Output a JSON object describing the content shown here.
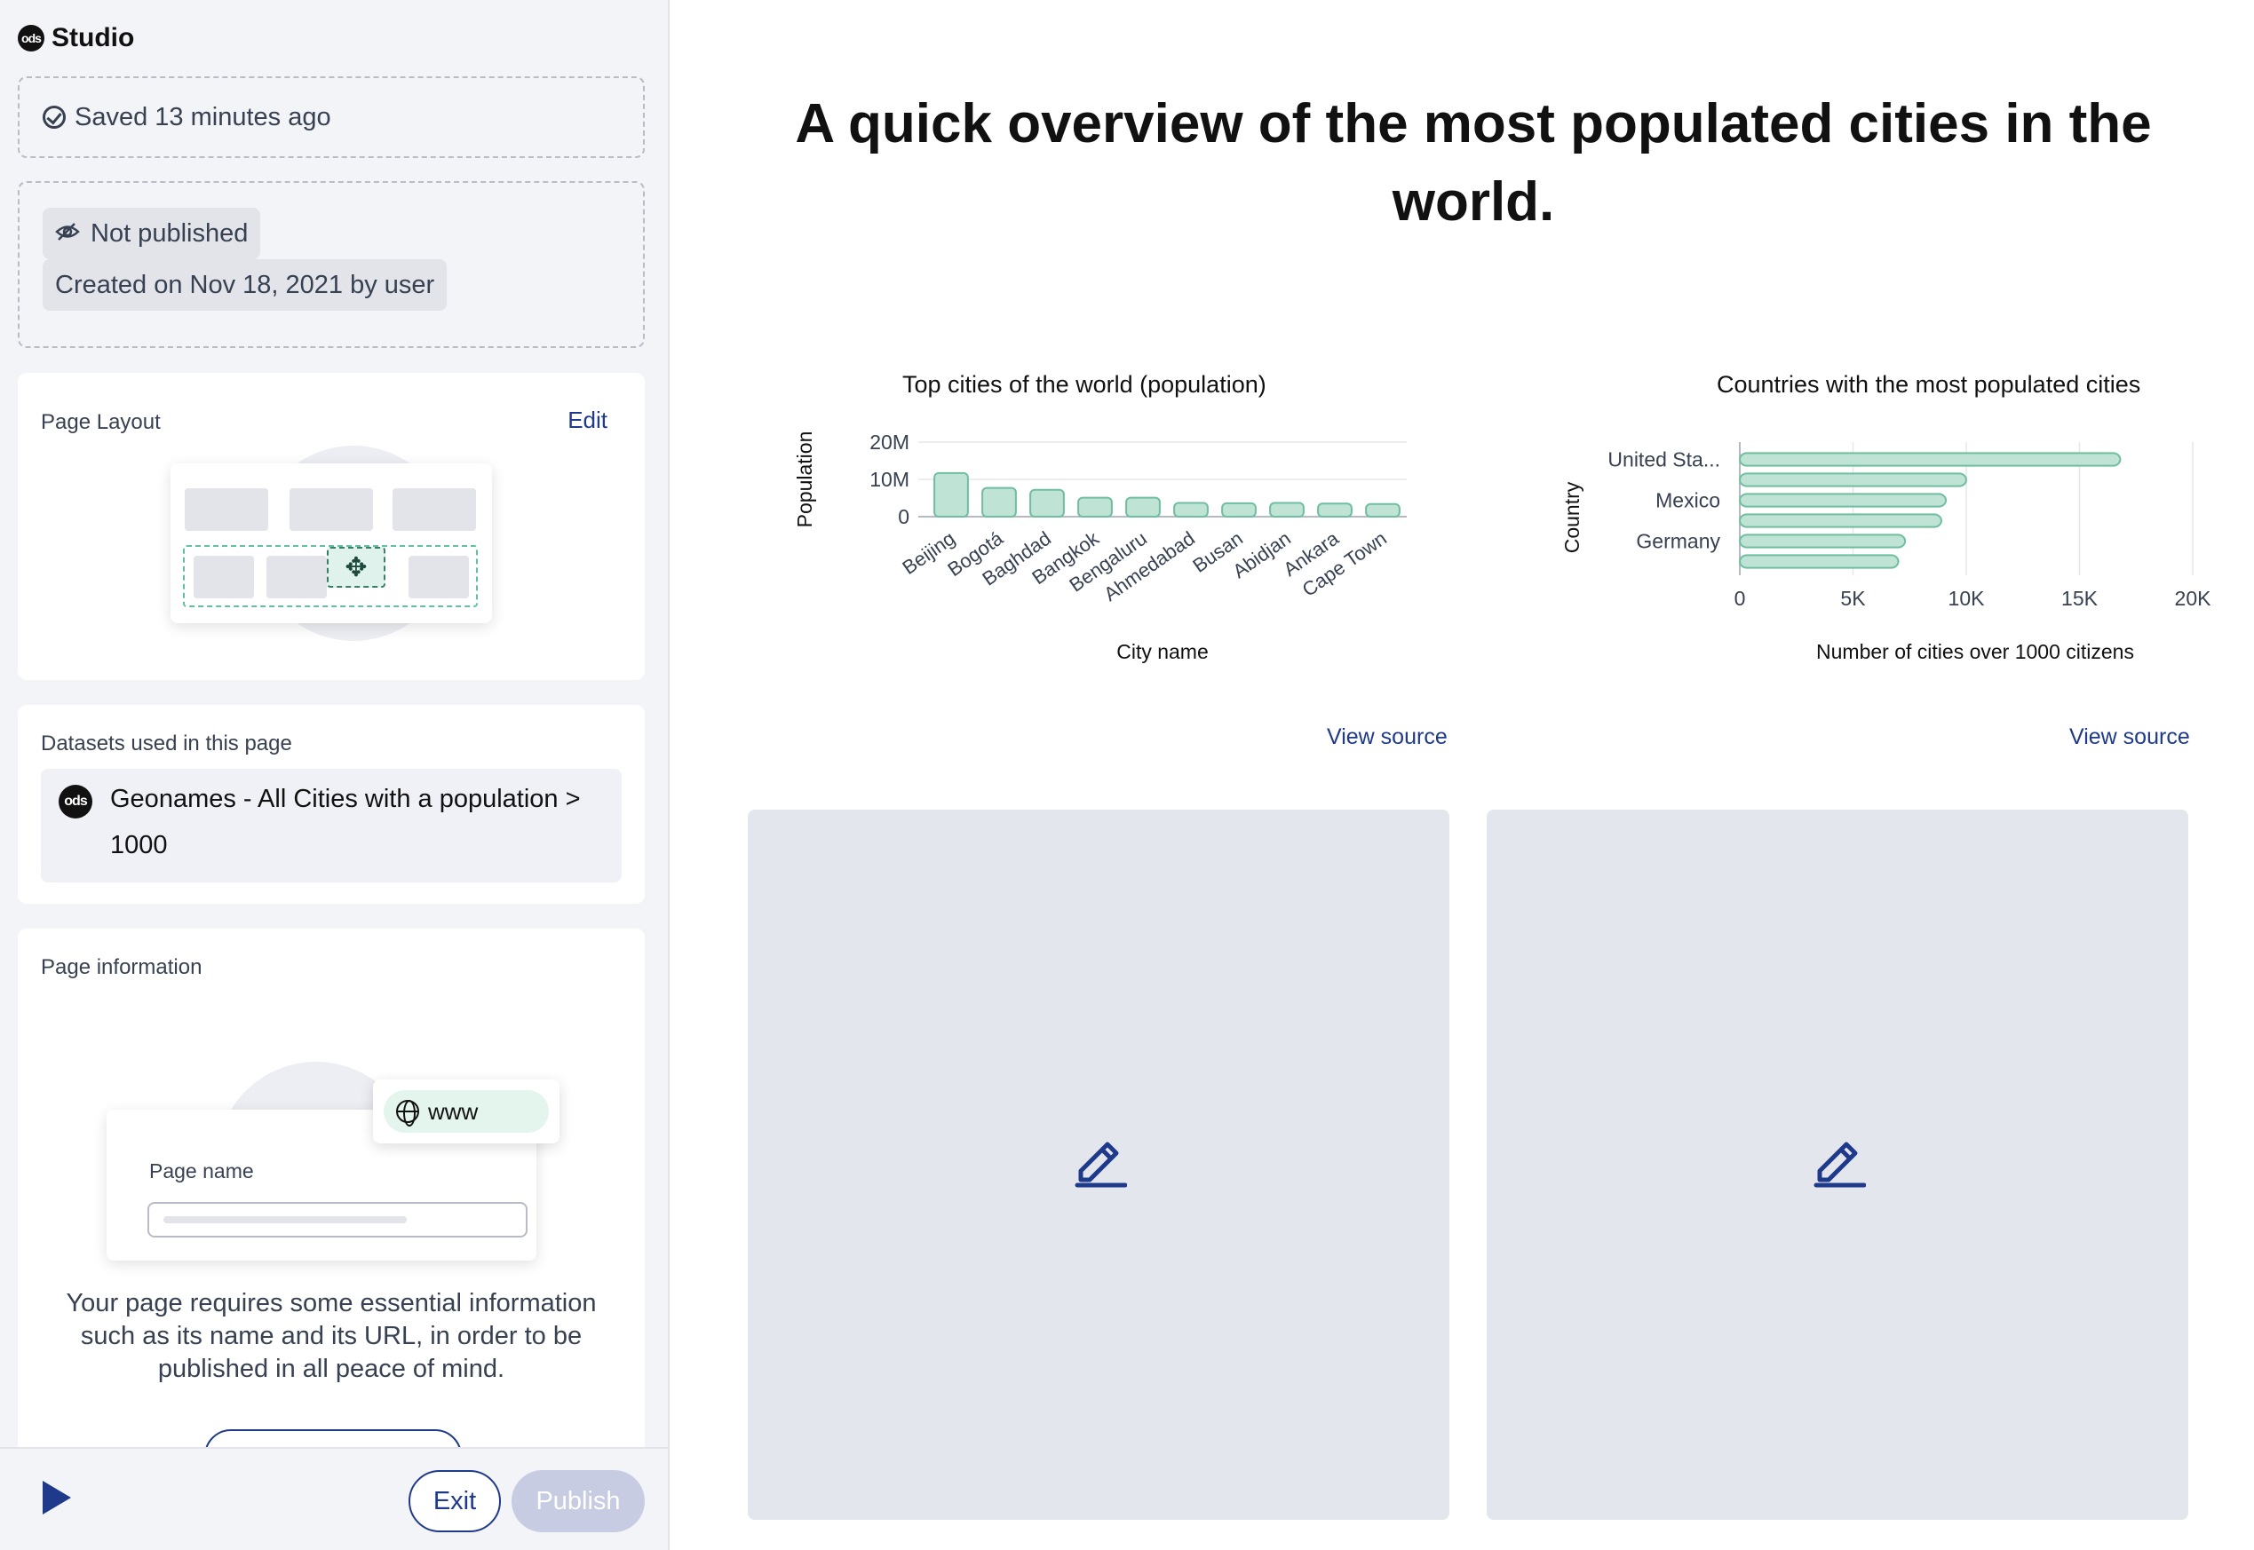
{
  "sidebar": {
    "brand": {
      "logo_text": "ods",
      "name": "Studio"
    },
    "save_status": "Saved 13 minutes ago",
    "publish_status": "Not published",
    "created": "Created on Nov 18, 2021 by user",
    "layout": {
      "label": "Page Layout",
      "edit": "Edit"
    },
    "datasets": {
      "label": "Datasets used in this page",
      "item": "Geonames - All Cities with a population > 1000",
      "logo_text": "ods"
    },
    "info": {
      "label": "Page information",
      "form_label": "Page name",
      "www": "www",
      "description": "Your page requires some essential information such as its name and its URL, in order to be published in all peace of mind."
    },
    "footer": {
      "exit": "Exit",
      "publish": "Publish"
    }
  },
  "main": {
    "title": "A quick overview of the most populated cities in the world.",
    "view_source": "View source"
  },
  "colors": {
    "bar_fill": "#bfe3d5",
    "bar_stroke": "#6fbf9f",
    "accent": "#1f3a8a",
    "placeholder_bg": "#e4e6ee"
  },
  "chart_data": [
    {
      "type": "bar",
      "title": "Top cities of the world (population)",
      "xlabel": "City name",
      "ylabel": "Population",
      "categories": [
        "Beijing",
        "Bogotá",
        "Baghdad",
        "Bangkok",
        "Bengaluru",
        "Ahmedabad",
        "Busan",
        "Abidjan",
        "Ankara",
        "Cape Town"
      ],
      "values": [
        11700000,
        7700000,
        7200000,
        5100000,
        5100000,
        3700000,
        3600000,
        3700000,
        3500000,
        3400000
      ],
      "yticks": [
        "0",
        "10M",
        "20M"
      ],
      "ylim": [
        0,
        20000000
      ],
      "grid": true
    },
    {
      "type": "bar",
      "orientation": "horizontal",
      "title": "Countries with the most populated cities",
      "xlabel": "Number of cities over 1000 citizens",
      "ylabel": "Country",
      "categories": [
        "United Sta...",
        "",
        "Mexico",
        "",
        "Germany",
        ""
      ],
      "values": [
        16800,
        10000,
        9100,
        8900,
        7300,
        7000
      ],
      "xticks": [
        "0",
        "5K",
        "10K",
        "15K",
        "20K"
      ],
      "xlim": [
        0,
        20000
      ],
      "grid": true
    }
  ]
}
